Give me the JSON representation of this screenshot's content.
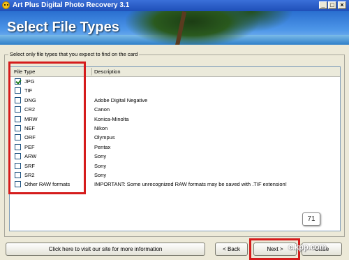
{
  "window": {
    "title": "Art Plus Digital Photo Recovery 3.1",
    "controls": {
      "minimize": "_",
      "maximize": "□",
      "close": "×"
    }
  },
  "banner": {
    "heading": "Select File Types"
  },
  "group": {
    "legend": "Select only file types that you expect to find on the card"
  },
  "list": {
    "columns": {
      "type": "File Type",
      "description": "Description"
    },
    "rows": [
      {
        "name": "JPG",
        "description": "",
        "checked": true
      },
      {
        "name": "TIF",
        "description": "",
        "checked": false
      },
      {
        "name": "DNG",
        "description": "Adobe Digital Negative",
        "checked": false
      },
      {
        "name": "CR2",
        "description": "Canon",
        "checked": false
      },
      {
        "name": "MRW",
        "description": "Konica-Minolta",
        "checked": false
      },
      {
        "name": "NEF",
        "description": "Nikon",
        "checked": false
      },
      {
        "name": "ORF",
        "description": "Olympus",
        "checked": false
      },
      {
        "name": "PEF",
        "description": "Pentax",
        "checked": false
      },
      {
        "name": "ARW",
        "description": "Sony",
        "checked": false
      },
      {
        "name": "SRF",
        "description": "Sony",
        "checked": false
      },
      {
        "name": "SR2",
        "description": "Sony",
        "checked": false
      },
      {
        "name": "Other RAW formats",
        "description": "IMPORTANT: Some unrecognized RAW formats may be saved with .TIF extension!",
        "checked": false
      }
    ]
  },
  "badge": "71",
  "buttons": {
    "visit": "Click here to visit our site for more information",
    "back": "< Back",
    "next": "Next >",
    "cancel": "Close"
  },
  "watermark": "c.kpp.com",
  "colors": {
    "highlight": "#d51c1c",
    "titlebar": "#1f4fb8"
  }
}
